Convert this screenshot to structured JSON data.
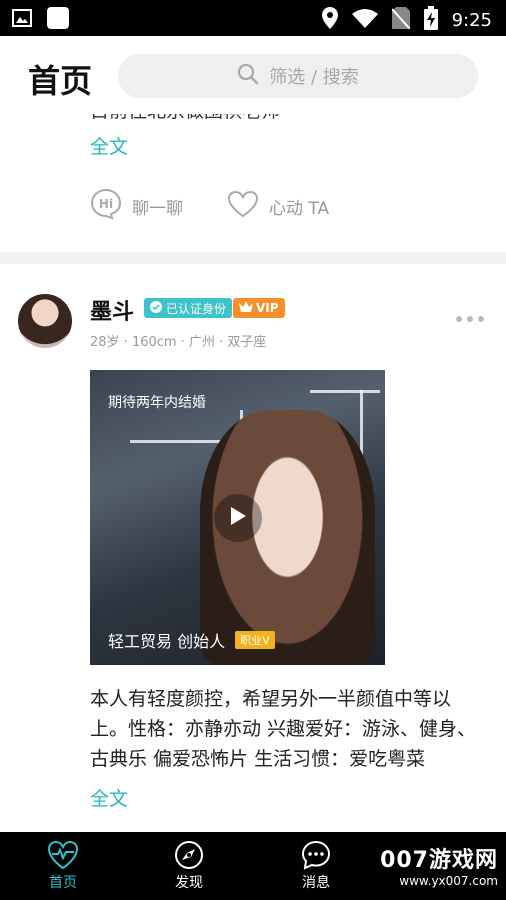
{
  "status_bar": {
    "time": "9:25"
  },
  "header": {
    "title": "首页",
    "search_placeholder": "筛选 / 搜索"
  },
  "card1": {
    "truncated_text": "目前住北京做围棋老师",
    "full_text_link": "全文",
    "chat_label": "聊一聊",
    "like_label": "心动 TA"
  },
  "card2": {
    "name": "墨斗",
    "verified_badge": "已认证身份",
    "vip_badge": "VIP",
    "meta": "28岁 · 160cm · 广州 · 双子座",
    "video_caption": "期待两年内结婚",
    "video_job": "轻工贸易 创始人",
    "video_job_badge": "职业V",
    "description": "本人有轻度颜控，希望另外一半颜值中等以上。性格：亦静亦动 兴趣爱好：游泳、健身、古典乐 偏爱恐怖片 生活习惯：爱吃粤菜",
    "full_text_link": "全文"
  },
  "tabbar": {
    "tabs": [
      {
        "label": "首页"
      },
      {
        "label": "发现"
      },
      {
        "label": "消息"
      }
    ],
    "watermark_big": "007游戏网",
    "watermark_small": "www.yx007.com"
  },
  "colors": {
    "accent": "#27b5c1",
    "vip": "#f7902a",
    "verify": "#3ec3c8"
  }
}
